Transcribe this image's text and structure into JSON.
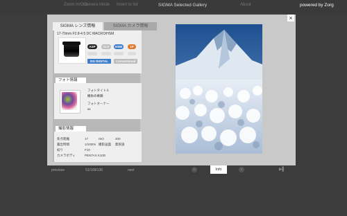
{
  "topbar": {
    "nav_items": [
      "Zoom In/Out",
      "Camera Mode",
      "Insert to list"
    ],
    "title": "SIGMA Selected Gallery",
    "aux": "About",
    "powered": "powered by Zorg"
  },
  "modal": {
    "close_label": "×",
    "tabs": [
      {
        "label": "SIGMA レンズ情報",
        "active": true
      },
      {
        "label": "SIGMA カメラ情報",
        "active": false
      }
    ],
    "lens": {
      "name": "17-70mm F2.8-4.5 DC MACRO/HSM",
      "badges": [
        "ASP",
        "SLD",
        "HSM",
        "1P",
        "DG",
        "Conventional"
      ],
      "feature_label": "DG DIGITAL"
    },
    "photo_info": {
      "heading": "フォト情報",
      "title_label": "フォトタイトル",
      "title_value": "樹氷の奇跡",
      "owner_label": "フォトオーナー",
      "owner_value": "xx"
    },
    "shooting": {
      "heading": "撮影情報",
      "rows": [
        {
          "k1": "焦点距離",
          "v1": "17",
          "k2": "ISO",
          "v2": "200"
        },
        {
          "k1": "露出時間",
          "v1": "1/1000s",
          "k2": "撮影画面",
          "v2": "無限遠"
        },
        {
          "k1": "絞り",
          "v1": "F10",
          "k2": "",
          "v2": ""
        },
        {
          "k1": "カメラボディ",
          "v1": "PENTAX K10D",
          "k2": "",
          "v2": ""
        }
      ]
    }
  },
  "bottom": {
    "previous": "previous",
    "counter": "51/109/136",
    "next": "next",
    "info": "Info",
    "prev_icon": "‹",
    "next_icon": "›",
    "play_icon": "▶▌"
  },
  "colors": {
    "background": "#3c3c3c",
    "modal": "#c9c9c9",
    "badge_black": "#222222",
    "badge_blue": "#3d7cc9",
    "badge_orange": "#e07a2a"
  }
}
